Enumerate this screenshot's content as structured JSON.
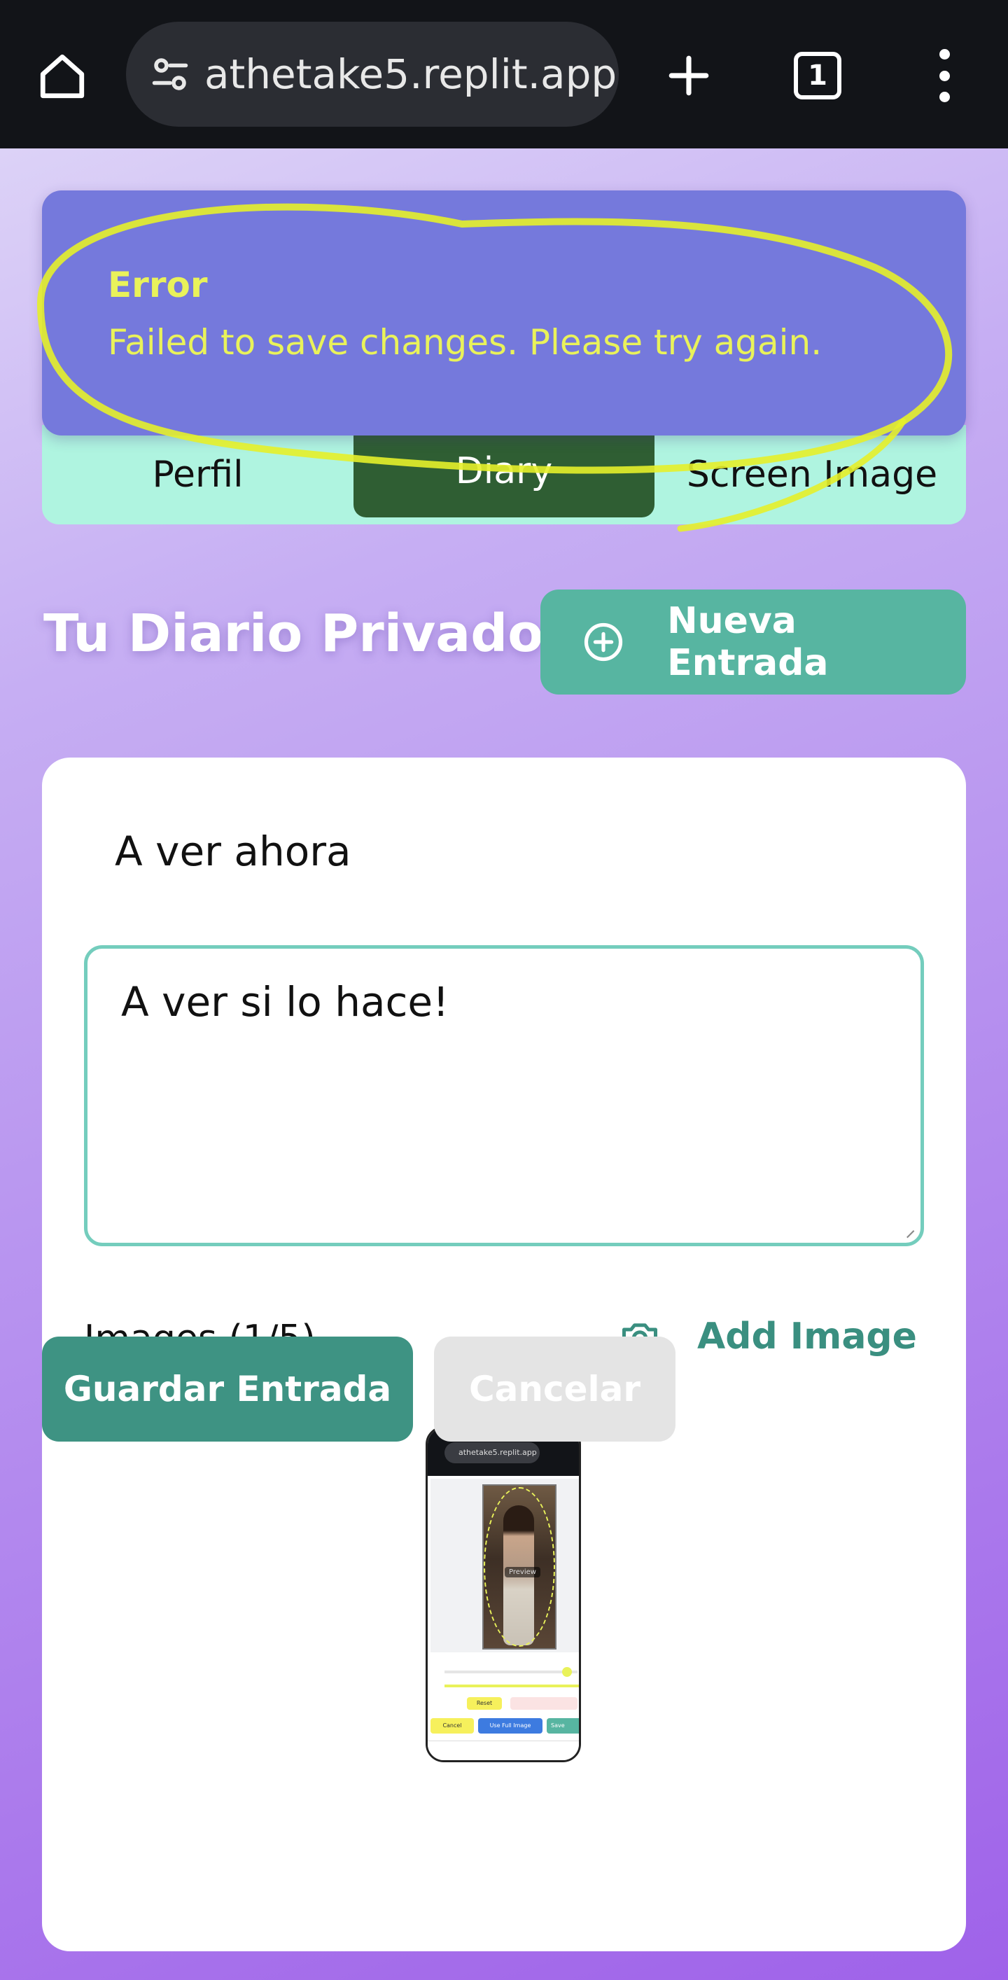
{
  "browser": {
    "url": "athetake5.replit.app",
    "tab_count": "1"
  },
  "toast": {
    "title": "Error",
    "message": "Failed to save changes. Please try again."
  },
  "tabs": [
    {
      "label": "Perfil",
      "active": false
    },
    {
      "label": "Diary",
      "active": true
    },
    {
      "label": "Screen Image",
      "active": false
    }
  ],
  "diary": {
    "heading": "Tu Diario Privado",
    "new_entry_label": "Nueva Entrada"
  },
  "entry": {
    "title": "A ver ahora",
    "body": "A ver si lo hace!",
    "images_label": "Images (1/5)",
    "add_image_label": "Add Image",
    "save_label": "Guardar Entrada",
    "cancel_label": "Cancelar"
  },
  "thumbnail": {
    "url": "athetake5.replit.app",
    "preview_label": "Preview",
    "reset_label": "Reset",
    "cancel_label": "Cancel",
    "full_label": "Use Full Image",
    "save_label": "Save"
  },
  "colors": {
    "toast_bg": "#7579dc",
    "toast_text": "#e9f25a",
    "tabbar_bg": "#aff4e0",
    "active_tab": "#2f5e33",
    "accent": "#57b5a1",
    "save_button": "#3e9383"
  },
  "icons": {
    "home": "home-icon",
    "site_settings": "tune-icon",
    "new_tab": "plus-icon",
    "tabs": "tab-count-icon",
    "menu": "more-vert-icon",
    "new_entry": "plus-circle-icon",
    "add_image": "camera-icon"
  }
}
